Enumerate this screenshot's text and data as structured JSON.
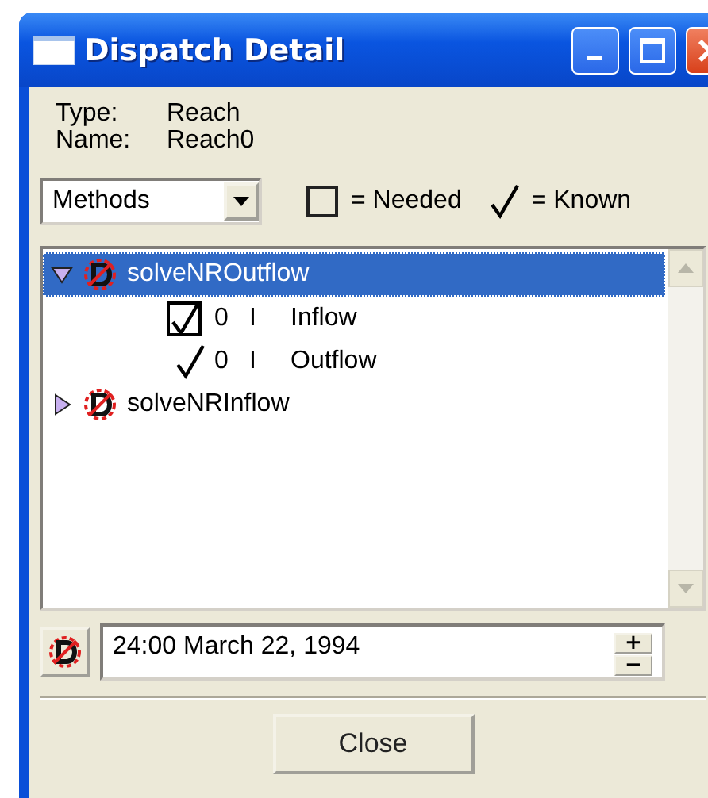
{
  "window": {
    "title": "Dispatch Detail"
  },
  "info": [
    {
      "label": "Type:",
      "value": "Reach"
    },
    {
      "label": "Name:",
      "value": "Reach0"
    }
  ],
  "view_select": {
    "value": "Methods"
  },
  "legend": [
    {
      "kind": "box",
      "label": "= Needed"
    },
    {
      "kind": "check",
      "label": "= Known"
    }
  ],
  "tree": [
    {
      "label": "solveNROutflow",
      "expanded": true,
      "selected": true,
      "children": [
        {
          "needed": true,
          "known": true,
          "column_1": "0",
          "column_2": "I",
          "column_3": "Inflow"
        },
        {
          "needed": false,
          "known": true,
          "column_1": "0",
          "column_2": "I",
          "column_3": "Outflow"
        }
      ]
    },
    {
      "label": "solveNRInflow",
      "expanded": false,
      "selected": false
    }
  ],
  "date_field": {
    "value": "24:00 March 22, 1994",
    "increment": "+",
    "decrement": "−"
  },
  "buttons": [
    "Close"
  ]
}
